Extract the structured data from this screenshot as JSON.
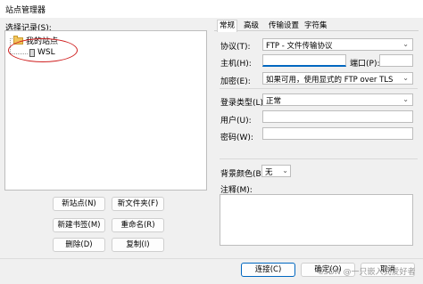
{
  "window": {
    "title": "站点管理器"
  },
  "left": {
    "select_label": "选择记录(S):",
    "tree": {
      "root": "我的站点",
      "child": "WSL"
    },
    "buttons": {
      "new_site": "新站点(N)",
      "new_folder": "新文件夹(F)",
      "new_bookmark": "新建书签(M)",
      "rename": "重命名(R)",
      "delete": "删除(D)",
      "copy": "复制(I)"
    }
  },
  "tabs": [
    "常规",
    "高级",
    "传输设置",
    "字符集"
  ],
  "general": {
    "protocol_label": "协议(T):",
    "protocol_value": "FTP - 文件传输协议",
    "host_label": "主机(H):",
    "host_value": "",
    "port_label": "端口(P):",
    "port_value": "",
    "encryption_label": "加密(E):",
    "encryption_value": "如果可用，使用显式的 FTP over TLS",
    "logon_type_label": "登录类型(L):",
    "logon_type_value": "正常",
    "user_label": "用户(U):",
    "user_value": "",
    "password_label": "密码(W):",
    "password_value": "",
    "bg_color_label": "背景颜色(B)",
    "bg_color_value": "无",
    "comments_label": "注释(M):"
  },
  "footer": {
    "connect": "连接(C)",
    "ok": "确定(O)",
    "cancel": "取消"
  },
  "watermark": "CSDN @一只嵌入式爱好者"
}
